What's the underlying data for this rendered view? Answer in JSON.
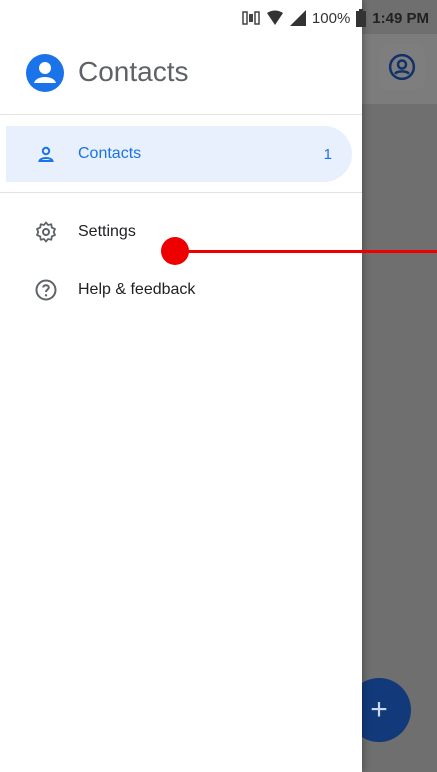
{
  "status_bar": {
    "battery": "100%",
    "time": "1:49 PM"
  },
  "drawer": {
    "app_title": "Contacts",
    "items": [
      {
        "label": "Contacts",
        "count": "1",
        "icon": "person-icon",
        "active": true
      },
      {
        "label": "Settings",
        "icon": "gear-icon"
      },
      {
        "label": "Help & feedback",
        "icon": "help-icon"
      }
    ]
  },
  "colors": {
    "accent": "#1a73e8",
    "selected_bg": "#e8f0fe",
    "fab": "#123a7a",
    "swipe_indicator": "#ee0000"
  },
  "fab": {
    "label": "+"
  }
}
